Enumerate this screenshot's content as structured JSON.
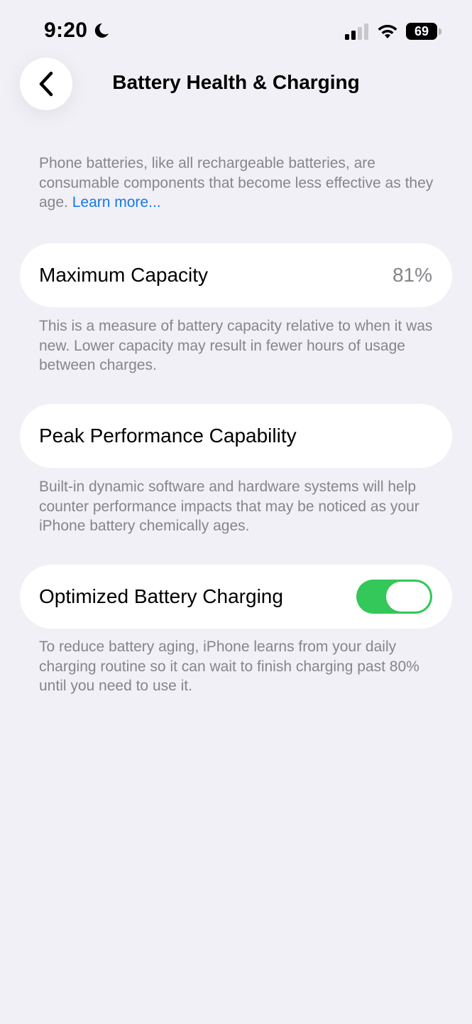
{
  "status_bar": {
    "time": "9:20",
    "battery_level": "69",
    "icons": [
      "moon-icon",
      "signal-icon",
      "wifi-icon",
      "battery-icon"
    ]
  },
  "nav": {
    "back_icon": "chevron-left-icon",
    "title": "Battery Health & Charging"
  },
  "intro": {
    "text": "Phone batteries, like all rechargeable batteries, are consumable components that become less effective as they age. ",
    "link": "Learn more..."
  },
  "max_capacity": {
    "label": "Maximum Capacity",
    "value": "81%",
    "description": "This is a measure of battery capacity relative to when it was new. Lower capacity may result in fewer hours of usage between charges."
  },
  "peak_performance": {
    "label": "Peak Performance Capability",
    "description": "Built-in dynamic software and hardware systems will help counter performance impacts that may be noticed as your iPhone battery chemically ages."
  },
  "optimized_charging": {
    "label": "Optimized Battery Charging",
    "enabled": true,
    "description": "To reduce battery aging, iPhone learns from your daily charging routine so it can wait to finish charging past 80% until you need to use it."
  },
  "colors": {
    "background": "#f1f0f6",
    "secondary_text": "#85858a",
    "link": "#1779e8",
    "toggle_on": "#34c759"
  }
}
